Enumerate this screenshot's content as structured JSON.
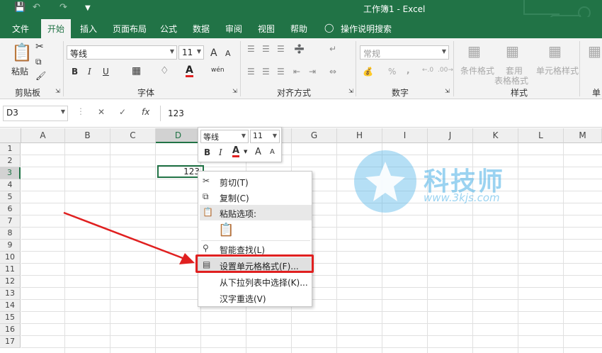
{
  "titlebar": {
    "title": "工作簿1 - Excel",
    "save_icon": "save-icon",
    "undo_icon": "undo-icon",
    "redo_icon": "redo-icon"
  },
  "tabs": [
    "文件",
    "开始",
    "插入",
    "页面布局",
    "公式",
    "数据",
    "审阅",
    "视图",
    "帮助",
    "操作说明搜索"
  ],
  "ribbon": {
    "clipboard": {
      "paste": "粘贴",
      "label": "剪贴板"
    },
    "font": {
      "name": "等线",
      "size": "11",
      "bold": "B",
      "italic": "I",
      "underline": "U",
      "grow": "A",
      "shrink": "A",
      "label": "字体",
      "font_color": "#e02020"
    },
    "alignment": {
      "label": "对齐方式"
    },
    "number": {
      "format": "常规",
      "percent": "%",
      "comma": ",",
      "label": "数字"
    },
    "styles": {
      "cond": "条件格式",
      "table1": "套用",
      "table2": "表格格式",
      "cell": "单元格样式",
      "label": "样式",
      "extra": "单"
    }
  },
  "formula_bar": {
    "name_box": "D3",
    "fx": "fx",
    "value": "123"
  },
  "columns": [
    "A",
    "B",
    "C",
    "D",
    "E",
    "F",
    "G",
    "H",
    "I",
    "J",
    "K",
    "L",
    "M"
  ],
  "rows": [
    "1",
    "2",
    "3",
    "4",
    "5",
    "6",
    "7",
    "8",
    "9",
    "10",
    "11",
    "12",
    "13",
    "14",
    "15",
    "16",
    "17"
  ],
  "cell": {
    "address": "D3",
    "value": "123"
  },
  "mini_toolbar": {
    "font": "等线",
    "size": "11",
    "bold": "B",
    "italic": "I",
    "color": "A",
    "grow": "A",
    "shrink": "A"
  },
  "context_menu": {
    "cut": "剪切(T)",
    "copy": "复制(C)",
    "paste_options": "粘贴选项:",
    "smart_lookup": "智能查找(L)",
    "format_cells": "设置单元格格式(F)...",
    "pick_list": "从下拉列表中选择(K)...",
    "reconvert": "汉字重选(V)"
  },
  "watermark": {
    "name": "科技师",
    "url": "www.3kjs.com"
  },
  "colors": {
    "excel_green": "#217346",
    "highlight_red": "#e02020",
    "watermark_blue": "#5ab7e8"
  }
}
